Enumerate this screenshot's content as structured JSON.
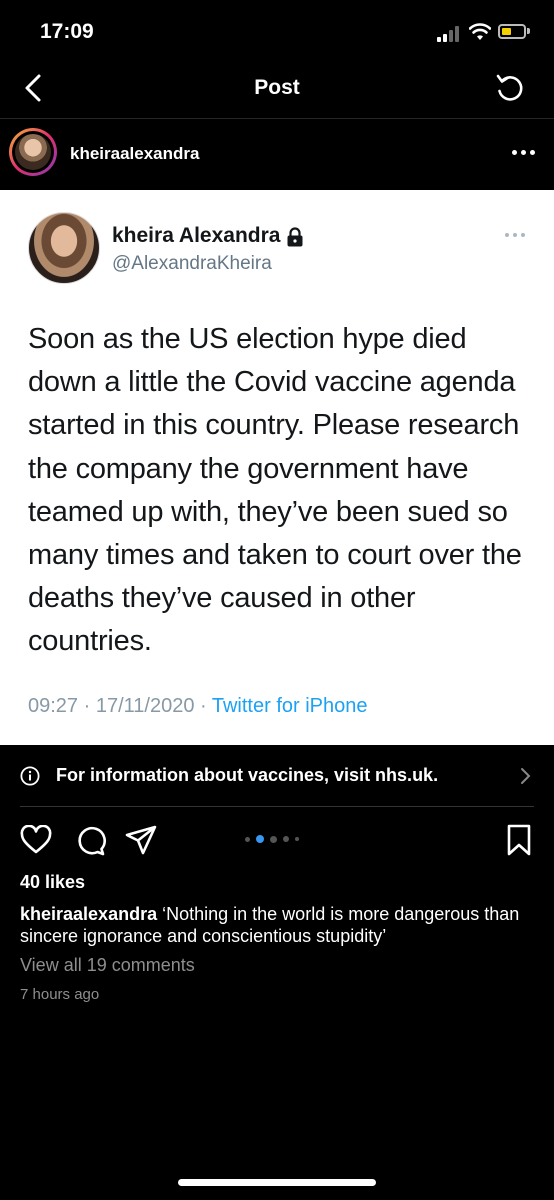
{
  "status_bar": {
    "time": "17:09"
  },
  "nav": {
    "title": "Post"
  },
  "post": {
    "username": "kheiraalexandra",
    "likes": "40 likes",
    "caption_user": "kheiraalexandra",
    "caption_text": "‘Nothing in the world is more dangerous than sincere ignorance and conscientious stupidity’",
    "view_comments": "View all 19 comments",
    "time_ago": "7 hours ago",
    "carousel": {
      "count": 5,
      "active_index": 1
    }
  },
  "tweet": {
    "name": "kheira Alexandra",
    "handle": "@AlexandraKheira",
    "text": "Soon as the US election hype died down a little the Covid vaccine agenda started in this country. Please research the company the government have teamed up with, they’ve been sued so many times and taken to court over the deaths they’ve caused in other countries.",
    "timestamp": "09:27 · 17/11/2020 · ",
    "source": "Twitter for iPhone"
  },
  "info_banner": {
    "text": "For information about vaccines, visit nhs.uk."
  },
  "colors": {
    "background": "#000000",
    "link_blue": "#1da1f2",
    "carousel_active": "#3897f0",
    "battery": "#f5d000"
  },
  "icons": [
    "back-icon",
    "refresh-icon",
    "more-icon",
    "lock-icon",
    "info-icon",
    "chevron-right-icon",
    "heart-icon",
    "comment-icon",
    "share-icon",
    "save-icon"
  ]
}
